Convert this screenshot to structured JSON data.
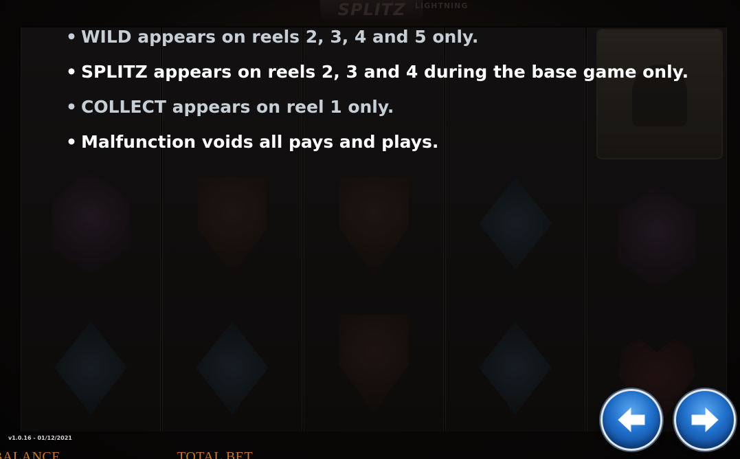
{
  "header": {
    "logo_text": "SPLITZ",
    "logo_subtext": "LIGHTNING"
  },
  "rules": [
    {
      "text": "WILD appears on reels 2, 3, 4 and 5 only.",
      "highlight": false
    },
    {
      "text": "SPLITZ appears on reels 2, 3 and 4 during the base game only.",
      "highlight": true
    },
    {
      "text": "COLLECT appears on reel 1 only.",
      "highlight": false
    },
    {
      "text": "Malfunction voids all pays and plays.",
      "highlight": true
    }
  ],
  "bullet": "•",
  "navigation": {
    "prev_icon": "arrow-left-icon",
    "next_icon": "arrow-right-icon",
    "button_color": "#1f6ec8"
  },
  "footer": {
    "version": "v1.0.16 - 01/12/2021",
    "balance_label": "BALANCE",
    "total_bet_label": "TOTAL BET",
    "label_color": "#c77a2c"
  }
}
